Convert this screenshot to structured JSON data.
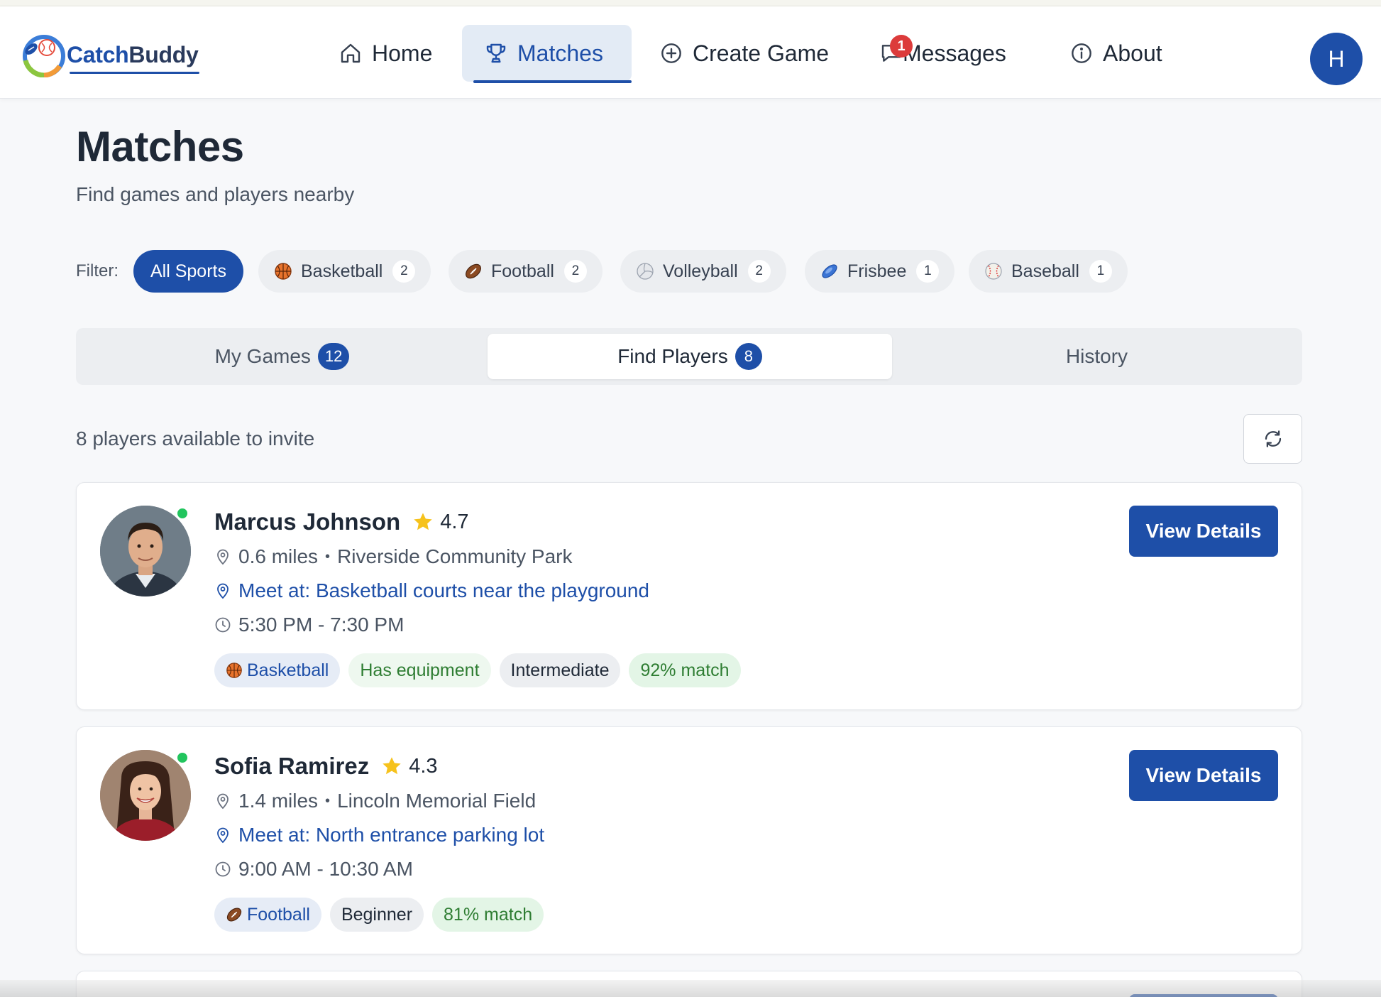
{
  "app": {
    "brand_catch": "Catch",
    "brand_buddy": "Buddy"
  },
  "nav": {
    "items": [
      {
        "label": "Home",
        "icon": "home-icon"
      },
      {
        "label": "Matches",
        "icon": "trophy-icon",
        "active": true
      },
      {
        "label": "Create Game",
        "icon": "plus-circle-icon"
      },
      {
        "label": "Messages",
        "icon": "message-icon",
        "badge": "1"
      },
      {
        "label": "About",
        "icon": "info-icon"
      }
    ],
    "user_initial": "H"
  },
  "page": {
    "title": "Matches",
    "subtitle": "Find games and players nearby"
  },
  "filter": {
    "label": "Filter:",
    "chips": [
      {
        "label": "All Sports",
        "active": true
      },
      {
        "label": "Basketball",
        "count": "2",
        "icon": "basketball-icon"
      },
      {
        "label": "Football",
        "count": "2",
        "icon": "football-icon"
      },
      {
        "label": "Volleyball",
        "count": "2",
        "icon": "volleyball-icon"
      },
      {
        "label": "Frisbee",
        "count": "1",
        "icon": "frisbee-icon"
      },
      {
        "label": "Baseball",
        "count": "1",
        "icon": "baseball-icon"
      }
    ]
  },
  "tabs": [
    {
      "label": "My Games",
      "count": "12"
    },
    {
      "label": "Find Players",
      "count": "8",
      "active": true
    },
    {
      "label": "History"
    }
  ],
  "results": {
    "summary": "8 players available to invite"
  },
  "players": [
    {
      "name": "Marcus Johnson",
      "rating": "4.7",
      "distance": "0.6 miles",
      "sep": "•",
      "park": "Riverside Community Park",
      "meet": "Meet at: Basketball courts near the playground",
      "time": "5:30 PM - 7:30 PM",
      "sport": "Basketball",
      "equipment": "Has equipment",
      "level": "Intermediate",
      "match": "92% match",
      "button": "View Details"
    },
    {
      "name": "Sofia Ramirez",
      "rating": "4.3",
      "distance": "1.4 miles",
      "sep": "•",
      "park": "Lincoln Memorial Field",
      "meet": "Meet at: North entrance parking lot",
      "time": "9:00 AM - 10:30 AM",
      "sport": "Football",
      "level": "Beginner",
      "match": "81% match",
      "button": "View Details"
    }
  ],
  "colors": {
    "primary": "#1e4fa8",
    "badge_red": "#dc3b3b",
    "online_green": "#22c55e",
    "match_green": "#2e7d32",
    "star_yellow": "#f6c21c"
  }
}
